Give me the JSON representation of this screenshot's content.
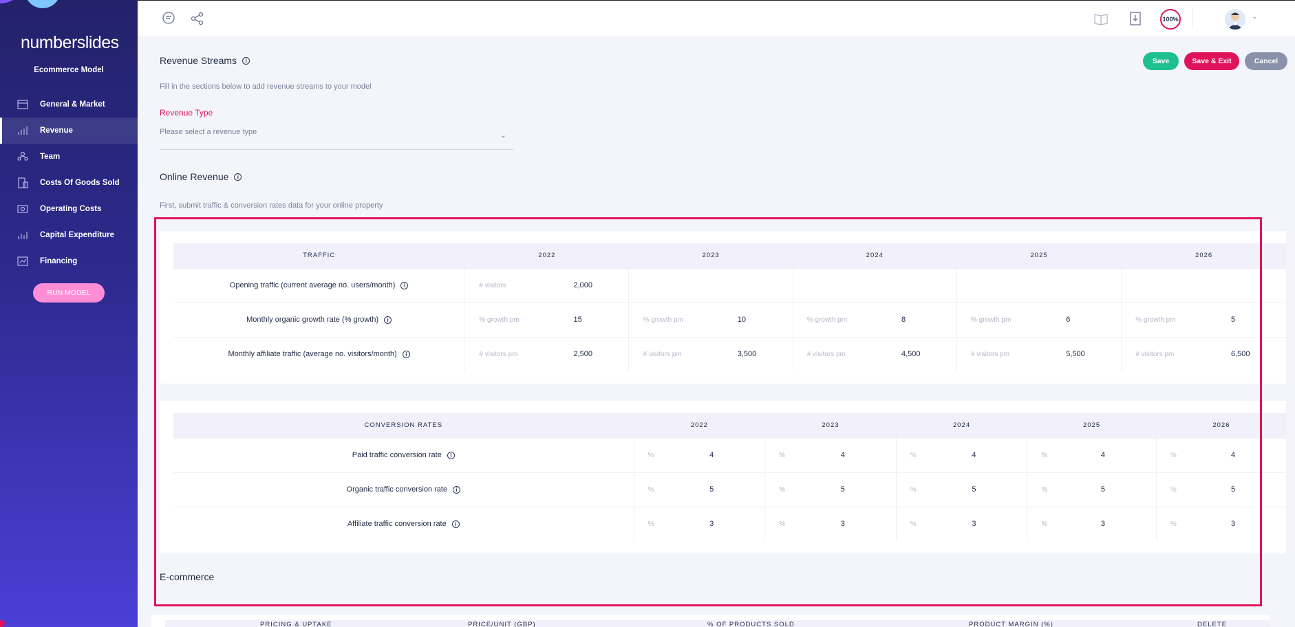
{
  "brand": "numberslides",
  "model_name": "Ecommerce Model",
  "nav": [
    {
      "label": "General & Market",
      "icon": "calendar-icon"
    },
    {
      "label": "Revenue",
      "icon": "chart-icon"
    },
    {
      "label": "Team",
      "icon": "team-icon"
    },
    {
      "label": "Costs Of Goods Sold",
      "icon": "cogs-icon"
    },
    {
      "label": "Operating Costs",
      "icon": "cost-icon"
    },
    {
      "label": "Capital Expenditure",
      "icon": "capex-icon"
    },
    {
      "label": "Financing",
      "icon": "financing-icon"
    }
  ],
  "run_model": "RUN MODEL",
  "topbar": {
    "progress": "100%"
  },
  "page": {
    "title": "Revenue Streams",
    "subtitle": "Fill in the sections below to add revenue streams to your model",
    "revenue_type_label": "Revenue Type",
    "revenue_type_placeholder": "Please select a revenue type",
    "online_title": "Online Revenue",
    "online_subtitle": "First, submit traffic & conversion rates data for your online property",
    "ecommerce_title": "E-commerce"
  },
  "buttons": {
    "save": "Save",
    "save_exit": "Save & Exit",
    "cancel": "Cancel"
  },
  "traffic": {
    "header": "TRAFFIC",
    "years": [
      "2022",
      "2023",
      "2024",
      "2025",
      "2026"
    ],
    "rows": [
      {
        "label": "Opening traffic (current average no. users/month)",
        "cells": [
          {
            "unit": "# visitors",
            "value": "2,000"
          }
        ]
      },
      {
        "label": "Monthly organic growth rate (% growth)",
        "cells": [
          {
            "unit": "% growth pm",
            "value": "15"
          },
          {
            "unit": "% growth pm",
            "value": "10"
          },
          {
            "unit": "% growth pm",
            "value": "8"
          },
          {
            "unit": "% growth pm",
            "value": "6"
          },
          {
            "unit": "% growth pm",
            "value": "5"
          }
        ]
      },
      {
        "label": "Monthly affiliate traffic (average no. visitors/month)",
        "cells": [
          {
            "unit": "# visitors pm",
            "value": "2,500"
          },
          {
            "unit": "# visitors pm",
            "value": "3,500"
          },
          {
            "unit": "# visitors pm",
            "value": "4,500"
          },
          {
            "unit": "# visitors pm",
            "value": "5,500"
          },
          {
            "unit": "# visitors pm",
            "value": "6,500"
          }
        ]
      }
    ]
  },
  "conversion": {
    "header": "CONVERSION RATES",
    "years": [
      "2022",
      "2023",
      "2024",
      "2025",
      "2026"
    ],
    "rows": [
      {
        "label": "Paid traffic conversion rate",
        "unit": "%",
        "values": [
          "4",
          "4",
          "4",
          "4",
          "4"
        ]
      },
      {
        "label": "Organic traffic conversion rate",
        "unit": "%",
        "values": [
          "5",
          "5",
          "5",
          "5",
          "5"
        ]
      },
      {
        "label": "Affiliate traffic conversion rate",
        "unit": "%",
        "values": [
          "3",
          "3",
          "3",
          "3",
          "3"
        ]
      }
    ]
  },
  "ecommerce_head": [
    "PRICING & UPTAKE",
    "PRICE/UNIT (GBP)",
    "% OF PRODUCTS SOLD",
    "PRODUCT MARGIN (%)",
    "DELETE"
  ]
}
